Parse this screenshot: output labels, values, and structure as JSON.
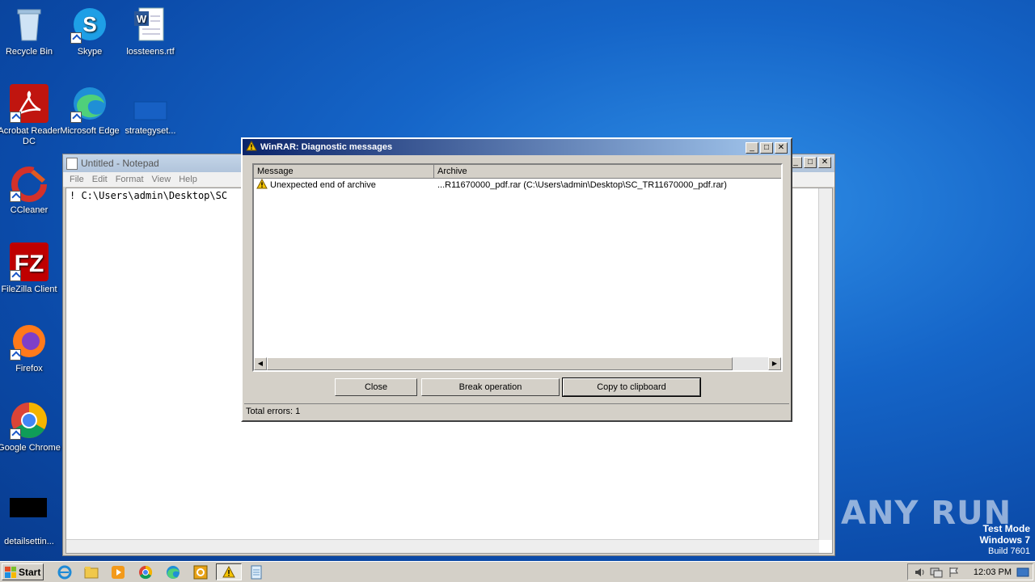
{
  "desktop": {
    "icons": [
      {
        "label": "Recycle Bin"
      },
      {
        "label": "Skype"
      },
      {
        "label": "lossteens.rtf"
      },
      {
        "label": "Acrobat Reader DC"
      },
      {
        "label": "Microsoft Edge"
      },
      {
        "label": "strategyset..."
      },
      {
        "label": "CCleaner"
      },
      {
        "label": "FileZilla Client"
      },
      {
        "label": "Firefox"
      },
      {
        "label": "Google Chrome"
      },
      {
        "label": "detailsettin..."
      }
    ]
  },
  "notepad": {
    "title": "Untitled - Notepad",
    "menu": [
      "File",
      "Edit",
      "Format",
      "View",
      "Help"
    ],
    "text": "! C:\\Users\\admin\\Desktop\\SC"
  },
  "dialog": {
    "title": "WinRAR: Diagnostic messages",
    "columns": [
      "Message",
      "Archive"
    ],
    "rows": [
      {
        "message": "Unexpected end of archive",
        "archive": "...R11670000_pdf.rar (C:\\Users\\admin\\Desktop\\SC_TR11670000_pdf.rar)"
      }
    ],
    "buttons": {
      "close": "Close",
      "break": "Break operation",
      "copy": "Copy to clipboard"
    },
    "status": "Total errors: 1"
  },
  "watermark": {
    "brand": "ANY RUN",
    "test_mode": "Test Mode",
    "os": "Windows 7",
    "build": "Build 7601"
  },
  "taskbar": {
    "start_label": "Start",
    "clock": "12:03 PM"
  }
}
